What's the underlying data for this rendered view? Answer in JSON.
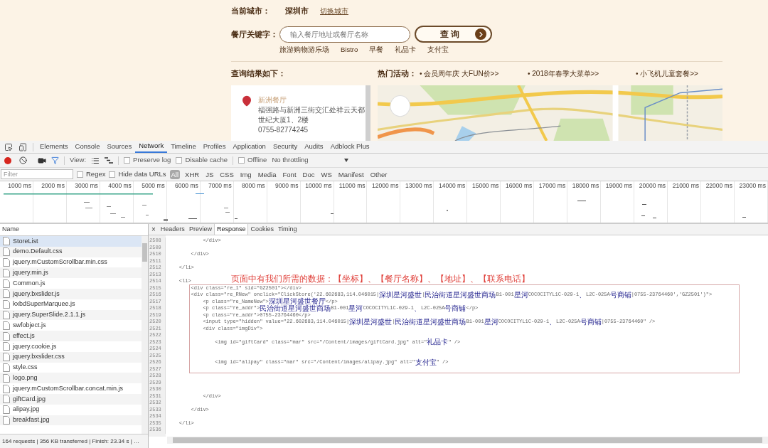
{
  "page": {
    "city_label": "当前城市：",
    "city": "深圳市",
    "switch_city": "切换城市",
    "keyword_label": "餐厅关键字：",
    "search_placeholder": "输入餐厅地址或餐厅名称",
    "search_button": "查 询",
    "quick_tags": [
      "旅游购物游乐场",
      "Bistro",
      "早餐",
      "礼品卡",
      "支付宝"
    ],
    "results_label": "查询结果如下：",
    "hot_label": "热门活动：",
    "promotions": [
      "• 会员周年庆 大FUN价>>",
      "• 2018年春季大菜单>>",
      "• 小飞机儿童套餐>>"
    ],
    "store": {
      "name": "新洲餐厅",
      "address": "福强路与新洲三街交汇处祥云天都世纪大厦1、2楼",
      "phone": "0755-82774245"
    }
  },
  "devtools": {
    "tabs": [
      {
        "label": "Elements",
        "selected": false
      },
      {
        "label": "Console",
        "selected": false
      },
      {
        "label": "Sources",
        "selected": false
      },
      {
        "label": "Network",
        "selected": true
      },
      {
        "label": "Timeline",
        "selected": false
      },
      {
        "label": "Profiles",
        "selected": false
      },
      {
        "label": "Application",
        "selected": false
      },
      {
        "label": "Security",
        "selected": false
      },
      {
        "label": "Audits",
        "selected": false
      },
      {
        "label": "Adblock Plus",
        "selected": false
      }
    ],
    "toolbar": {
      "view_label": "View:",
      "options": [
        {
          "label": "Preserve log",
          "checked": false
        },
        {
          "label": "Disable cache",
          "checked": false
        },
        {
          "label": "Offline",
          "checked": false
        }
      ],
      "throttling": "No throttling"
    },
    "filter": {
      "placeholder": "Filter",
      "options": [
        {
          "label": "Regex",
          "checked": false
        },
        {
          "label": "Hide data URLs",
          "checked": false
        }
      ],
      "types": [
        {
          "label": "All",
          "selected": true
        },
        {
          "label": "XHR",
          "selected": false
        },
        {
          "label": "JS",
          "selected": false
        },
        {
          "label": "CSS",
          "selected": false
        },
        {
          "label": "Img",
          "selected": false
        },
        {
          "label": "Media",
          "selected": false
        },
        {
          "label": "Font",
          "selected": false
        },
        {
          "label": "Doc",
          "selected": false
        },
        {
          "label": "WS",
          "selected": false
        },
        {
          "label": "Manifest",
          "selected": false
        },
        {
          "label": "Other",
          "selected": false
        }
      ]
    },
    "timeline": {
      "ticks": [
        "1000 ms",
        "2000 ms",
        "3000 ms",
        "4000 ms",
        "5000 ms",
        "6000 ms",
        "7000 ms",
        "8000 ms",
        "9000 ms",
        "10000 ms",
        "11000 ms",
        "12000 ms",
        "13000 ms",
        "14000 ms",
        "15000 ms",
        "16000 ms",
        "17000 ms",
        "18000 ms",
        "19000 ms",
        "20000 ms",
        "21000 ms",
        "22000 ms",
        "23000 ms"
      ]
    },
    "requests": {
      "column": "Name",
      "items": [
        {
          "name": "StoreList",
          "selected": true
        },
        {
          "name": "demo.Default.css",
          "selected": false
        },
        {
          "name": "jquery.mCustomScrollbar.min.css",
          "selected": false
        },
        {
          "name": "jquery.min.js",
          "selected": false
        },
        {
          "name": "Common.js",
          "selected": false
        },
        {
          "name": "jquery.bxslider.js",
          "selected": false
        },
        {
          "name": "kxbdSuperMarquee.js",
          "selected": false
        },
        {
          "name": "jquery.SuperSlide.2.1.1.js",
          "selected": false
        },
        {
          "name": "swfobject.js",
          "selected": false
        },
        {
          "name": "effect.js",
          "selected": false
        },
        {
          "name": "jquery.cookie.js",
          "selected": false
        },
        {
          "name": "jquery.bxslider.css",
          "selected": false
        },
        {
          "name": "style.css",
          "selected": false
        },
        {
          "name": "logo.png",
          "selected": false
        },
        {
          "name": "jquery.mCustomScrollbar.concat.min.js",
          "selected": false
        },
        {
          "name": "giftCard.jpg",
          "selected": false
        },
        {
          "name": "alipay.jpg",
          "selected": false
        },
        {
          "name": "breakfast.jpg",
          "selected": false
        }
      ],
      "summary": "164 requests | 356 KB transferred | Finish: 23.34 s | …"
    },
    "detail": {
      "close": "×",
      "tabs": [
        {
          "label": "Headers",
          "selected": false
        },
        {
          "label": "Preview",
          "selected": false
        },
        {
          "label": "Response",
          "selected": true
        },
        {
          "label": "Cookies",
          "selected": false
        },
        {
          "label": "Timing",
          "selected": false
        }
      ],
      "blocks": [
        {
          "kind": "plain",
          "lines": [
            {
              "number": "2508",
              "text": "            </div>"
            },
            {
              "number": "2509"
            },
            {
              "number": "2510",
              "text": "        </div>"
            },
            {
              "number": "2511"
            },
            {
              "number": "2512",
              "text": "    </li>"
            },
            {
              "number": "2513"
            },
            {
              "number": "2514",
              "text": "    <li>"
            }
          ]
        },
        {
          "kind": "highlight",
          "note": "页面中有我们所需的数据：【坐标】、【餐厅名称】、【地址】、【联系电话】",
          "lines": [
            {
              "number": "2515",
              "text": "        <div class=\"re_1\" sid=\"GZ2501\"></div>"
            },
            {
              "number": "2516",
              "text": "        <div class=\"re_RNew\" onclick=\"ClickStore('22.602683,114.046015|深圳星河盛世|民治街道星河盛世商场B1-001星河COCOCITYL1C-029-1、L2C-025A号商铺|0755-23764460','GZ2501')\">"
            },
            {
              "number": "2517",
              "text": "            <p class=\"re_NameNew\">深圳星河盛世餐厅</p>"
            },
            {
              "number": "2518",
              "text": "            <p class=\"re_addr\">民治街道星河盛世商场B1-001星河COCOCITYL1C-029-1、L2C-025A号商铺</p>"
            },
            {
              "number": "2519",
              "text": "            <p class=\"re_addr\">0755-23764460</p>"
            },
            {
              "number": "2520",
              "text": "            <input type=\"hidden\" value=\"22.602683,114.046015|深圳星河盛世|民治街道星河盛世商场B1-001星河COCOCITYL1C-029-1、L2C-025A号商铺|0755-23764460\" />"
            },
            {
              "number": "2521",
              "text": "            <div class=\"imgDiv\">"
            },
            {
              "number": "2522"
            },
            {
              "number": "2523",
              "text": "                <img id=\"giftCard\" class=\"mar\" src=\"/Content/images/giftCard.jpg\" alt=\"礼品卡\" />"
            },
            {
              "number": "2524"
            },
            {
              "number": "2525"
            },
            {
              "number": "2526",
              "text": "                <img id=\"alipay\" class=\"mar\" src=\"/Content/images/alipay.jpg\" alt=\"支付宝\" />"
            },
            {
              "number": "2527"
            }
          ]
        },
        {
          "kind": "plain",
          "lines": [
            {
              "number": "2528"
            },
            {
              "number": "2529"
            },
            {
              "number": "2530"
            },
            {
              "number": "2531",
              "text": "            </div>"
            },
            {
              "number": "2532"
            },
            {
              "number": "2533",
              "text": "        </div>"
            },
            {
              "number": "2534"
            },
            {
              "number": "2535",
              "text": "    </li>"
            },
            {
              "number": "2536"
            }
          ]
        }
      ]
    }
  }
}
